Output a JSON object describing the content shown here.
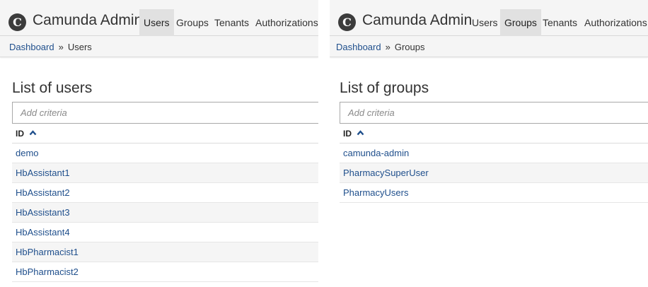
{
  "users_panel": {
    "brand": "Camunda Admin",
    "logo_glyph": "C",
    "nav": [
      "Users",
      "Groups",
      "Tenants",
      "Authorizations"
    ],
    "active_nav": 0,
    "breadcrumb": {
      "link": "Dashboard",
      "separator": "»",
      "current": "Users"
    },
    "title": "List of users",
    "search_placeholder": "Add criteria",
    "column_header": "ID",
    "rows": [
      "demo",
      "HbAssistant1",
      "HbAssistant2",
      "HbAssistant3",
      "HbAssistant4",
      "HbPharmacist1",
      "HbPharmacist2"
    ]
  },
  "groups_panel": {
    "brand": "Camunda Admin",
    "logo_glyph": "C",
    "nav": [
      "Users",
      "Groups",
      "Tenants",
      "Authorizations"
    ],
    "active_nav": 1,
    "breadcrumb": {
      "link": "Dashboard",
      "separator": "»",
      "current": "Groups"
    },
    "title": "List of groups",
    "search_placeholder": "Add criteria",
    "column_header": "ID",
    "rows": [
      "camunda-admin",
      "PharmacySuperUser",
      "PharmacyUsers"
    ]
  },
  "colors": {
    "link": "#1f4f8c",
    "navbar_bg": "#f5f5f5",
    "active_tab_bg": "#e1e1e1",
    "logo_bg": "#3c3c3c"
  },
  "icons": {
    "sort": "chevron-up-icon"
  }
}
